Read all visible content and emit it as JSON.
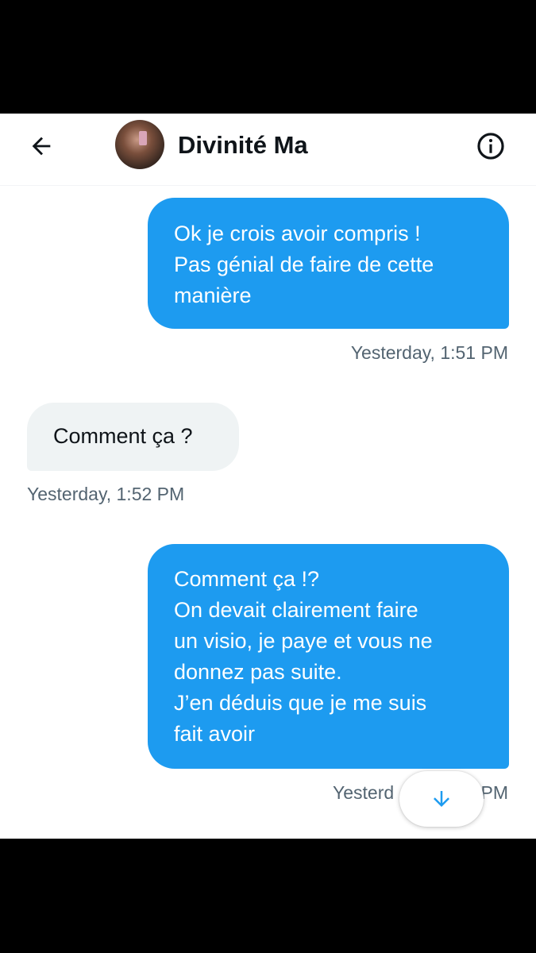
{
  "header": {
    "contact_name": "Divinité Ma",
    "back_icon": "arrow-left-icon",
    "info_icon": "info-icon"
  },
  "messages": [
    {
      "direction": "sent",
      "lines": [
        "Ok je crois avoir compris !",
        "Pas génial de faire de cette",
        "manière"
      ],
      "timestamp": "Yesterday, 1:51 PM"
    },
    {
      "direction": "received",
      "lines": [
        "Comment ça ?"
      ],
      "timestamp": "Yesterday, 1:52 PM"
    },
    {
      "direction": "sent",
      "lines": [
        "Comment ça !?",
        "On devait clairement faire",
        "un visio, je paye et vous ne",
        "donnez pas suite.",
        "J’en déduis que je me suis",
        "fait avoir"
      ],
      "timestamp_left": "Yesterd",
      "timestamp_right": "PM"
    }
  ],
  "scroll_button": {
    "icon": "arrow-down-icon"
  },
  "colors": {
    "accent": "#1d9bf0",
    "received_bubble": "#eff3f4",
    "text_primary": "#0f1419",
    "text_secondary": "#536471"
  }
}
